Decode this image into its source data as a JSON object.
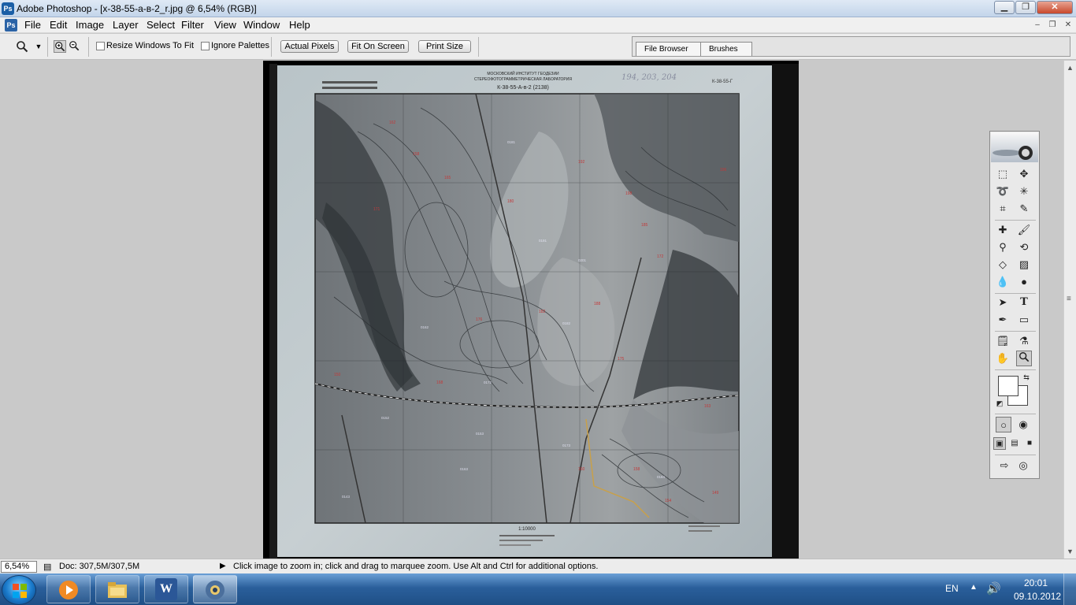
{
  "window": {
    "title": "Adobe Photoshop - [x-38-55-а-в-2_r.jpg @ 6,54% (RGB)]"
  },
  "window_controls": {
    "minimize": "▁",
    "maximize": "❐",
    "close": "✕"
  },
  "doc_controls": {
    "minimize": "–",
    "restore": "❐",
    "close": "✕"
  },
  "menu": [
    "File",
    "Edit",
    "Image",
    "Layer",
    "Select",
    "Filter",
    "View",
    "Window",
    "Help"
  ],
  "options": {
    "resize_windows_label": "Resize Windows To Fit",
    "ignore_palettes_label": "Ignore Palettes",
    "actual_pixels": "Actual Pixels",
    "fit_on_screen": "Fit On Screen",
    "print_size": "Print Size"
  },
  "palette_well": {
    "tabs": [
      "File Browser",
      "Brushes"
    ]
  },
  "document": {
    "header_lines": [
      "МОСКОВСКИЙ ИНСТИТУТ ГЕОДЕЗИИ",
      "СТЕРЕОФОТОГРАММЕТРИЧЕСКАЯ ЛАБОРАТОРИЯ",
      "К-38-55-А-в-2 (2138)"
    ],
    "handwritten_top": "194, 203, 204",
    "sheet_id": "К-38-55-Г",
    "scale_caption": "1:10000"
  },
  "status": {
    "zoom": "6,54%",
    "doc_info": "Doc: 307,5M/307,5M",
    "hint": "Click image to zoom in; click and drag to marquee zoom.  Use Alt and Ctrl for additional options."
  },
  "taskbar": {
    "items": [
      "media-player",
      "file-explorer",
      "word",
      "photoshop"
    ],
    "word_label": "W",
    "language": "EN",
    "time": "20:01",
    "date": "09.10.2012"
  }
}
